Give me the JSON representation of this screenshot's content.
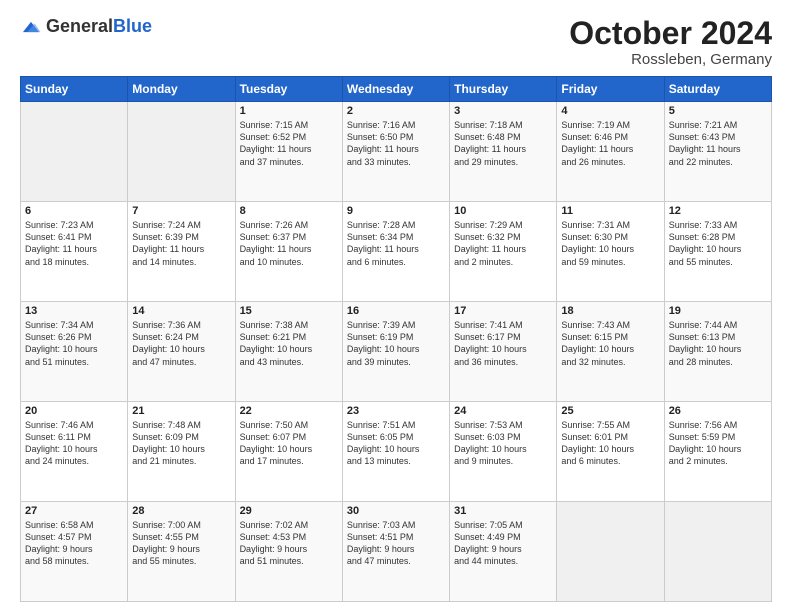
{
  "header": {
    "logo_general": "General",
    "logo_blue": "Blue",
    "month": "October 2024",
    "location": "Rossleben, Germany"
  },
  "days_of_week": [
    "Sunday",
    "Monday",
    "Tuesday",
    "Wednesday",
    "Thursday",
    "Friday",
    "Saturday"
  ],
  "weeks": [
    [
      {
        "day": "",
        "info": ""
      },
      {
        "day": "",
        "info": ""
      },
      {
        "day": "1",
        "info": "Sunrise: 7:15 AM\nSunset: 6:52 PM\nDaylight: 11 hours\nand 37 minutes."
      },
      {
        "day": "2",
        "info": "Sunrise: 7:16 AM\nSunset: 6:50 PM\nDaylight: 11 hours\nand 33 minutes."
      },
      {
        "day": "3",
        "info": "Sunrise: 7:18 AM\nSunset: 6:48 PM\nDaylight: 11 hours\nand 29 minutes."
      },
      {
        "day": "4",
        "info": "Sunrise: 7:19 AM\nSunset: 6:46 PM\nDaylight: 11 hours\nand 26 minutes."
      },
      {
        "day": "5",
        "info": "Sunrise: 7:21 AM\nSunset: 6:43 PM\nDaylight: 11 hours\nand 22 minutes."
      }
    ],
    [
      {
        "day": "6",
        "info": "Sunrise: 7:23 AM\nSunset: 6:41 PM\nDaylight: 11 hours\nand 18 minutes."
      },
      {
        "day": "7",
        "info": "Sunrise: 7:24 AM\nSunset: 6:39 PM\nDaylight: 11 hours\nand 14 minutes."
      },
      {
        "day": "8",
        "info": "Sunrise: 7:26 AM\nSunset: 6:37 PM\nDaylight: 11 hours\nand 10 minutes."
      },
      {
        "day": "9",
        "info": "Sunrise: 7:28 AM\nSunset: 6:34 PM\nDaylight: 11 hours\nand 6 minutes."
      },
      {
        "day": "10",
        "info": "Sunrise: 7:29 AM\nSunset: 6:32 PM\nDaylight: 11 hours\nand 2 minutes."
      },
      {
        "day": "11",
        "info": "Sunrise: 7:31 AM\nSunset: 6:30 PM\nDaylight: 10 hours\nand 59 minutes."
      },
      {
        "day": "12",
        "info": "Sunrise: 7:33 AM\nSunset: 6:28 PM\nDaylight: 10 hours\nand 55 minutes."
      }
    ],
    [
      {
        "day": "13",
        "info": "Sunrise: 7:34 AM\nSunset: 6:26 PM\nDaylight: 10 hours\nand 51 minutes."
      },
      {
        "day": "14",
        "info": "Sunrise: 7:36 AM\nSunset: 6:24 PM\nDaylight: 10 hours\nand 47 minutes."
      },
      {
        "day": "15",
        "info": "Sunrise: 7:38 AM\nSunset: 6:21 PM\nDaylight: 10 hours\nand 43 minutes."
      },
      {
        "day": "16",
        "info": "Sunrise: 7:39 AM\nSunset: 6:19 PM\nDaylight: 10 hours\nand 39 minutes."
      },
      {
        "day": "17",
        "info": "Sunrise: 7:41 AM\nSunset: 6:17 PM\nDaylight: 10 hours\nand 36 minutes."
      },
      {
        "day": "18",
        "info": "Sunrise: 7:43 AM\nSunset: 6:15 PM\nDaylight: 10 hours\nand 32 minutes."
      },
      {
        "day": "19",
        "info": "Sunrise: 7:44 AM\nSunset: 6:13 PM\nDaylight: 10 hours\nand 28 minutes."
      }
    ],
    [
      {
        "day": "20",
        "info": "Sunrise: 7:46 AM\nSunset: 6:11 PM\nDaylight: 10 hours\nand 24 minutes."
      },
      {
        "day": "21",
        "info": "Sunrise: 7:48 AM\nSunset: 6:09 PM\nDaylight: 10 hours\nand 21 minutes."
      },
      {
        "day": "22",
        "info": "Sunrise: 7:50 AM\nSunset: 6:07 PM\nDaylight: 10 hours\nand 17 minutes."
      },
      {
        "day": "23",
        "info": "Sunrise: 7:51 AM\nSunset: 6:05 PM\nDaylight: 10 hours\nand 13 minutes."
      },
      {
        "day": "24",
        "info": "Sunrise: 7:53 AM\nSunset: 6:03 PM\nDaylight: 10 hours\nand 9 minutes."
      },
      {
        "day": "25",
        "info": "Sunrise: 7:55 AM\nSunset: 6:01 PM\nDaylight: 10 hours\nand 6 minutes."
      },
      {
        "day": "26",
        "info": "Sunrise: 7:56 AM\nSunset: 5:59 PM\nDaylight: 10 hours\nand 2 minutes."
      }
    ],
    [
      {
        "day": "27",
        "info": "Sunrise: 6:58 AM\nSunset: 4:57 PM\nDaylight: 9 hours\nand 58 minutes."
      },
      {
        "day": "28",
        "info": "Sunrise: 7:00 AM\nSunset: 4:55 PM\nDaylight: 9 hours\nand 55 minutes."
      },
      {
        "day": "29",
        "info": "Sunrise: 7:02 AM\nSunset: 4:53 PM\nDaylight: 9 hours\nand 51 minutes."
      },
      {
        "day": "30",
        "info": "Sunrise: 7:03 AM\nSunset: 4:51 PM\nDaylight: 9 hours\nand 47 minutes."
      },
      {
        "day": "31",
        "info": "Sunrise: 7:05 AM\nSunset: 4:49 PM\nDaylight: 9 hours\nand 44 minutes."
      },
      {
        "day": "",
        "info": ""
      },
      {
        "day": "",
        "info": ""
      }
    ]
  ]
}
